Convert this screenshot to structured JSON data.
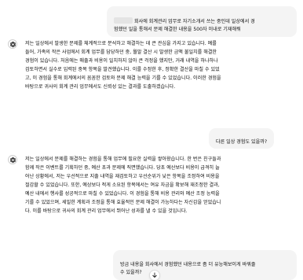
{
  "messages": {
    "user1": "회사에 회계관리 업무로 자기소개서 쓰는 중인데 일상에서 경\n험했던 일을 통해서 문제 해결한 내용을 500자 이내로 기재해줘",
    "assistant1": "저는 일상에서 발생한 문제를 체계적으로 분석하고 해결하는 데 큰 관심을 가지고 있습니다. 예를\n들어, 가족의 작은 사업에서 회계 업무를 담당하던 중, 월말 결산 시 발생한 금액 불일치를 해결한\n경험이 있습니다. 처음에는 매출과 비용이 일치하지 않아 큰 걱정을 했지만, 거래 내역을 하나하나\n검토하면서 실수로 입력된 중복 항목을 발견했습니다. 이를 수정한 후, 정확한 결산을 마칠 수 있었\n고, 이 경험을 통해 회계에서의 꼼꼼한 검토와 문제 해결 능력을 기를 수 있었습니다. 이러한 경험을\n바탕으로 귀사의 회계 관리 업무에서도 신뢰성 있는 결과를 도출하겠습니다.",
    "user2": "다른 일상 경험도 있을까?",
    "assistant2": "저는 일상에서 문제를 해결하는 경험을 통해 업무에 필요한 실력을 쌓아왔습니다. 한 번은 친구들과\n함께 작은 이벤트를 기획하던 중, 예산 초과 문제에 직면했습니다. 당초 예산보다 비용이 급격히 늘\n어난 상황에서, 저는 우선적으로 지출 내역을 재검토하고 우선순위가 낮은 항목을 조정하여 비용을\n절감할 수 있었습니다. 또한, 예상보다 적게 소요된 항목에서는 여유 자금을 확보해 재조정한 결과,\n예산 내에서 행사를 성공적으로 마칠 수 있었습니다. 이 경험을 통해 비용 관리와 예산 조정 능력을\n기를 수 있었으며, 세밀한 계획과 조정을 통해 효율적인 문제 해결이 가능하다는 자신감을 얻었습니\n다. 이를 바탕으로 귀사의 회계 관리 업무에서 뛰어난 성과를 낼 수 있을 것입니다.",
    "user3": "방금 내용을 회사에서 경험했던 내용으로 좀 더 유능해보이게 바꿔줄\n수 있을까?"
  },
  "icons": {
    "assistant_avatar": "openai-logo-icon",
    "scroll_down": "arrow-down-icon"
  },
  "colors": {
    "user_bubble": "#f4f4f4",
    "text": "#0d0d0d"
  }
}
